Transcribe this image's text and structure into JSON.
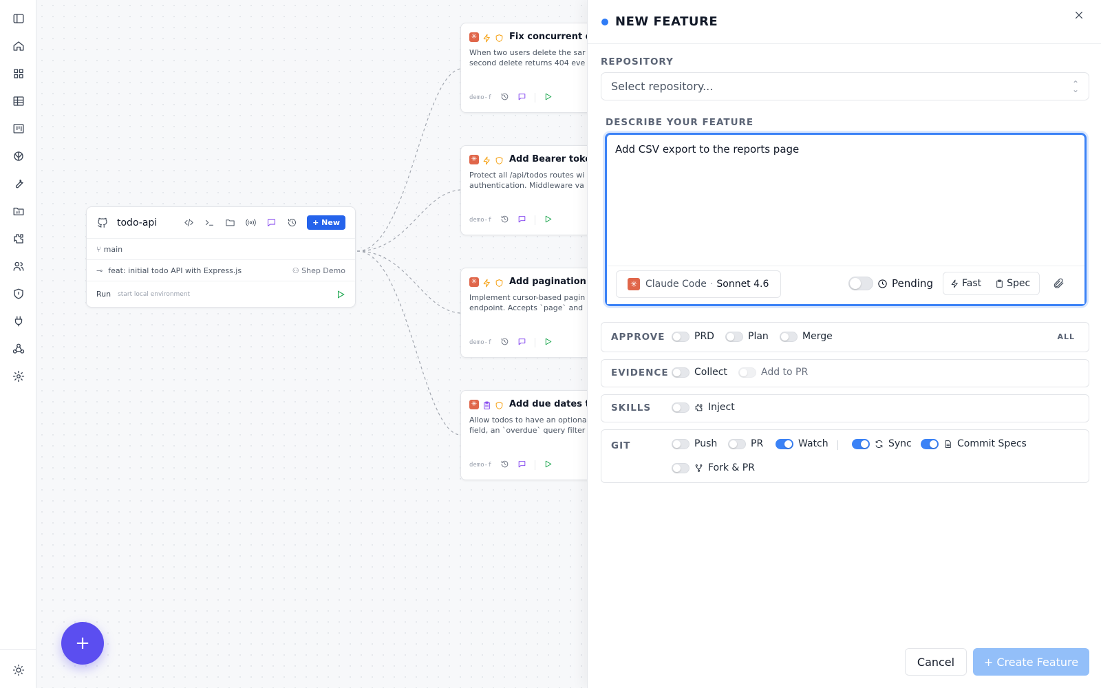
{
  "repo": {
    "name": "todo-api",
    "new_button": "+ New",
    "branch": "main",
    "commit": "feat: initial todo API with Express.js",
    "author": "Shep Demo",
    "run_label": "Run",
    "run_hint": "start local environment"
  },
  "features": [
    {
      "title": "Fix concurrent d",
      "desc": "When two users delete the sar\nsecond delete returns 404 eve",
      "code": "demo-f"
    },
    {
      "title": "Add Bearer toke",
      "desc": "Protect all /api/todos routes wi\nauthentication. Middleware va",
      "code": "demo-f"
    },
    {
      "title": "Add pagination",
      "desc": "Implement cursor-based pagin\nendpoint. Accepts `page` and",
      "code": "demo-f"
    },
    {
      "title": "Add due dates t",
      "desc": "Allow todos to have an optiona\nfield, an `overdue` query filter",
      "code": "demo-f"
    }
  ],
  "fab_label": "+",
  "panel": {
    "title": "NEW FEATURE",
    "repository_label": "REPOSITORY",
    "repository_placeholder": "Select repository...",
    "describe_label": "DESCRIBE YOUR FEATURE",
    "describe_value": "Add CSV export to the reports page",
    "agent_name": "Claude Code",
    "agent_sep": "·",
    "agent_model": "Sonnet 4.6",
    "pending_label": "Pending",
    "fast_label": "Fast",
    "spec_label": "Spec",
    "approve": {
      "label": "APPROVE",
      "prd": "PRD",
      "plan": "Plan",
      "merge": "Merge",
      "all": "ALL"
    },
    "evidence": {
      "label": "EVIDENCE",
      "collect": "Collect",
      "add_to_pr": "Add to PR"
    },
    "skills": {
      "label": "SKILLS",
      "inject": "Inject"
    },
    "git": {
      "label": "GIT",
      "push": "Push",
      "pr": "PR",
      "watch": "Watch",
      "sync": "Sync",
      "commit_specs": "Commit Specs",
      "fork_pr": "Fork & PR"
    },
    "toggles": {
      "watch": true,
      "sync": true,
      "commit_specs": true,
      "push": false,
      "pr": false,
      "fork_pr": false
    },
    "cancel_label": "Cancel",
    "create_label": "+ Create Feature"
  },
  "colors": {
    "accent": "#3b82f6",
    "fab": "#5b4ef0",
    "claude": "#e0664a",
    "run_green": "#16a34a"
  }
}
